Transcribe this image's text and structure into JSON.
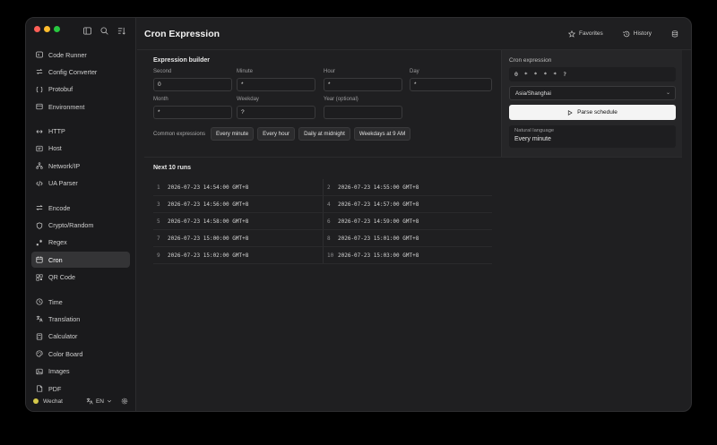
{
  "header": {
    "title": "Cron Expression",
    "favorites": "Favorites",
    "history": "History"
  },
  "sidebar": {
    "groups": [
      [
        "Code Runner",
        "Config Converter",
        "Protobuf",
        "Environment"
      ],
      [
        "HTTP",
        "Host",
        "Network/IP",
        "UA Parser"
      ],
      [
        "Encode",
        "Crypto/Random",
        "Regex",
        "Cron",
        "QR Code"
      ],
      [
        "Time",
        "Translation",
        "Calculator",
        "Color Board",
        "Images",
        "PDF"
      ]
    ],
    "items": [
      "Code Runner",
      "Config Converter",
      "Protobuf",
      "Environment",
      "HTTP",
      "Host",
      "Network/IP",
      "UA Parser",
      "Encode",
      "Crypto/Random",
      "Regex",
      "Cron",
      "QR Code",
      "Time",
      "Translation",
      "Calculator",
      "Color Board",
      "Images",
      "PDF"
    ],
    "active": "Cron",
    "footer": {
      "user": "Wechat",
      "lang": "EN"
    }
  },
  "builder": {
    "title": "Expression builder",
    "fields": [
      {
        "label": "Second",
        "value": "0"
      },
      {
        "label": "Minute",
        "value": "*"
      },
      {
        "label": "Hour",
        "value": "*"
      },
      {
        "label": "Day",
        "value": "*"
      },
      {
        "label": "Month",
        "value": "*"
      },
      {
        "label": "Weekday",
        "value": "?"
      },
      {
        "label": "Year (optional)",
        "value": ""
      }
    ],
    "common_label": "Common expressions",
    "common": [
      "Every minute",
      "Every hour",
      "Daily at midnight",
      "Weekdays at 9 AM"
    ]
  },
  "panel": {
    "title": "Cron expression",
    "expression": "0 * * * * ?",
    "timezone": "Asia/Shanghai",
    "parse": "Parse schedule",
    "nl_label": "Natural language",
    "nl_value": "Every minute"
  },
  "runs": {
    "title": "Next 10 runs",
    "items": [
      "2026-07-23 14:54:00 GMT+8",
      "2026-07-23 14:55:00 GMT+8",
      "2026-07-23 14:56:00 GMT+8",
      "2026-07-23 14:57:00 GMT+8",
      "2026-07-23 14:58:00 GMT+8",
      "2026-07-23 14:59:00 GMT+8",
      "2026-07-23 15:00:00 GMT+8",
      "2026-07-23 15:01:00 GMT+8",
      "2026-07-23 15:02:00 GMT+8",
      "2026-07-23 15:03:00 GMT+8"
    ]
  },
  "colors": {
    "accent": "#f4f4f4",
    "traffic": [
      "#ff5f57",
      "#febc2e",
      "#28c840"
    ]
  }
}
